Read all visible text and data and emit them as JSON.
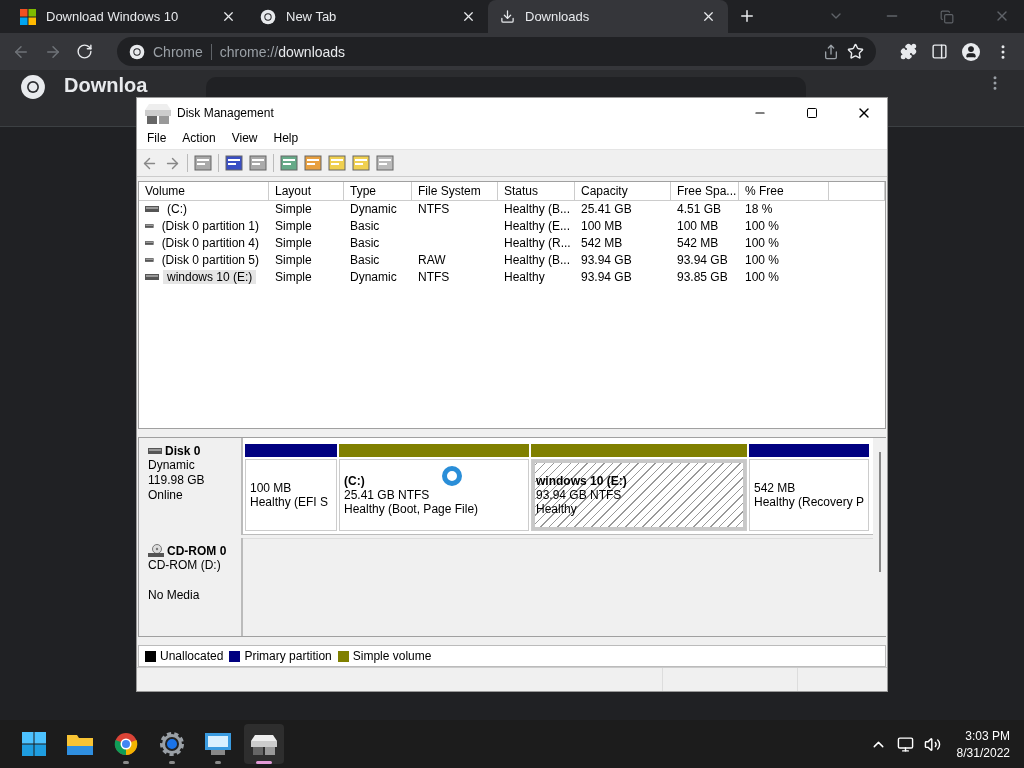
{
  "browser": {
    "tabs": [
      {
        "title": "Download Windows 10",
        "selected": false
      },
      {
        "title": "New Tab",
        "selected": false
      },
      {
        "title": "Downloads",
        "selected": true
      }
    ],
    "address": {
      "label": "Chrome",
      "scheme": "chrome://",
      "host": "downloads"
    },
    "page_title": "Downloa"
  },
  "dialog": {
    "title": "Disk Management",
    "menu": [
      "File",
      "Action",
      "View",
      "Help"
    ],
    "columns": [
      "Volume",
      "Layout",
      "Type",
      "File System",
      "Status",
      "Capacity",
      "Free Spa...",
      "% Free"
    ],
    "rows": [
      {
        "cells": [
          " (C:)",
          "Simple",
          "Dynamic",
          "NTFS",
          "Healthy (B...",
          "25.41 GB",
          "4.51 GB",
          "18 %"
        ],
        "selected": false
      },
      {
        "cells": [
          "(Disk 0 partition 1)",
          "Simple",
          "Basic",
          "",
          "Healthy (E...",
          "100 MB",
          "100 MB",
          "100 %"
        ],
        "selected": false
      },
      {
        "cells": [
          "(Disk 0 partition 4)",
          "Simple",
          "Basic",
          "",
          "Healthy (R...",
          "542 MB",
          "542 MB",
          "100 %"
        ],
        "selected": false
      },
      {
        "cells": [
          "(Disk 0 partition 5)",
          "Simple",
          "Basic",
          "RAW",
          "Healthy (B...",
          "93.94 GB",
          "93.94 GB",
          "100 %"
        ],
        "selected": false
      },
      {
        "cells": [
          "windows 10 (E:)",
          "Simple",
          "Dynamic",
          "NTFS",
          "Healthy",
          "93.94 GB",
          "93.85 GB",
          "100 %"
        ],
        "selected": true
      }
    ],
    "disks": [
      {
        "kind": "disk",
        "name": "Disk 0",
        "details": [
          "Dynamic",
          "119.98 GB",
          "Online"
        ],
        "partitions": [
          {
            "kind": "primary",
            "lines": [
              "100 MB",
              "Healthy (EFI S"
            ],
            "selected": false
          },
          {
            "kind": "simple",
            "name": " (C:)",
            "lines": [
              "25.41 GB NTFS",
              "Healthy (Boot, Page File)"
            ],
            "selected": false,
            "busy": true
          },
          {
            "kind": "simple",
            "name": "windows 10  (E:)",
            "lines": [
              "93.94 GB NTFS",
              "Healthy"
            ],
            "selected": true
          },
          {
            "kind": "primary",
            "lines": [
              "542 MB",
              "Healthy (Recovery P"
            ],
            "selected": false
          }
        ]
      },
      {
        "kind": "cdrom",
        "name": "CD-ROM 0",
        "details": [
          "CD-ROM (D:)",
          "No Media"
        ]
      }
    ],
    "legend": [
      {
        "label": "Unallocated",
        "color": "#000000"
      },
      {
        "label": "Primary partition",
        "color": "#000080"
      },
      {
        "label": "Simple volume",
        "color": "#808000"
      }
    ]
  },
  "taskbar": {
    "apps": [
      {
        "kind": "start",
        "selected": false
      },
      {
        "kind": "folder",
        "selected": false
      },
      {
        "kind": "chrome",
        "selected": false
      },
      {
        "kind": "settings",
        "selected": false
      },
      {
        "kind": "panel",
        "selected": false
      },
      {
        "kind": "disk",
        "selected": true
      }
    ],
    "time": "3:03 PM",
    "date": "8/31/2022"
  }
}
